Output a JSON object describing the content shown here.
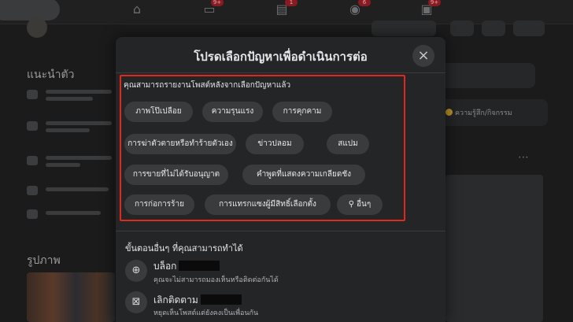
{
  "background": {
    "nav_badges": [
      "9+",
      "1",
      "6",
      "9+"
    ],
    "section_intro": "แนะนำตัว",
    "section_photos": "รูปภาพ",
    "feeling_label": "ความรู้สึก/กิจกรรม"
  },
  "modal": {
    "title": "โปรดเลือกปัญหาเพื่อดำเนินการต่อ",
    "close_icon": "×",
    "prompt": "คุณสามารถรายงานโพสต์หลังจากเลือกปัญหาแล้ว",
    "problems": [
      "ภาพโป๊เปลือย",
      "ความรุนแรง",
      "การคุกคาม",
      "การฆ่าตัวตายหรือทำร้ายตัวเอง",
      "ข่าวปลอม",
      "สแปม",
      "การขายที่ไม่ได้รับอนุญาต",
      "คำพูดที่แสดงความเกลียดชัง",
      "การก่อการร้าย",
      "การแทรกแซงผู้มีสิทธิ์เลือกตั้ง",
      "อื่นๆ"
    ],
    "other_steps_title": "ขั้นตอนอื่นๆ ที่คุณสามารถทำได้",
    "actions": [
      {
        "title": "บล็อก",
        "subtitle": "คุณจะไม่สามารถมองเห็นหรือติดต่อกันได้",
        "icon": "block-user-icon"
      },
      {
        "title": "เลิกติดตาม",
        "subtitle": "หยุดเห็นโพสต์แต่ยังคงเป็นเพื่อนกัน",
        "icon": "unfollow-icon"
      }
    ],
    "highlight_color": "#e0281c"
  }
}
